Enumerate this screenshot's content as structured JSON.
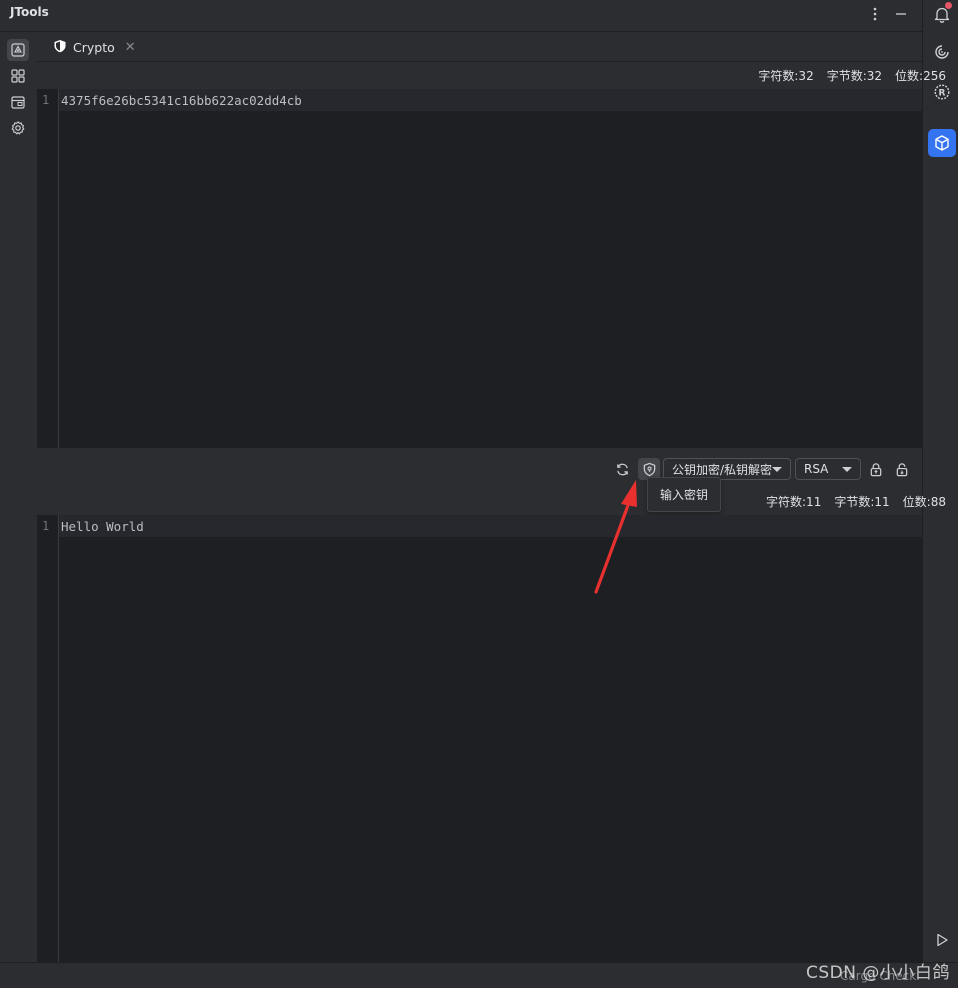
{
  "window": {
    "title": "JTools"
  },
  "tab": {
    "label": "Crypto"
  },
  "top_stats": {
    "chars": "字符数:32",
    "bytes": "字节数:32",
    "bits": "位数:256"
  },
  "top_editor": {
    "line_number": "1",
    "text": "4375f6e26bc5341c16bb622ac02dd4cb"
  },
  "toolbar": {
    "mode_select": "公钥加密/私钥解密",
    "algorithm_select": "RSA",
    "tooltip": "输入密钥"
  },
  "bottom_stats": {
    "chars": "字符数:11",
    "bytes": "字节数:11",
    "bits": "位数:88"
  },
  "bottom_editor": {
    "line_number": "1",
    "text": "Hello World"
  },
  "status_bar": {
    "text": "Cargo Check"
  },
  "watermark": "CSDN @小小白鸽",
  "colors": {
    "accent": "#3574f0",
    "annotation_arrow": "#e8302f",
    "notification_dot": "#e55765"
  }
}
